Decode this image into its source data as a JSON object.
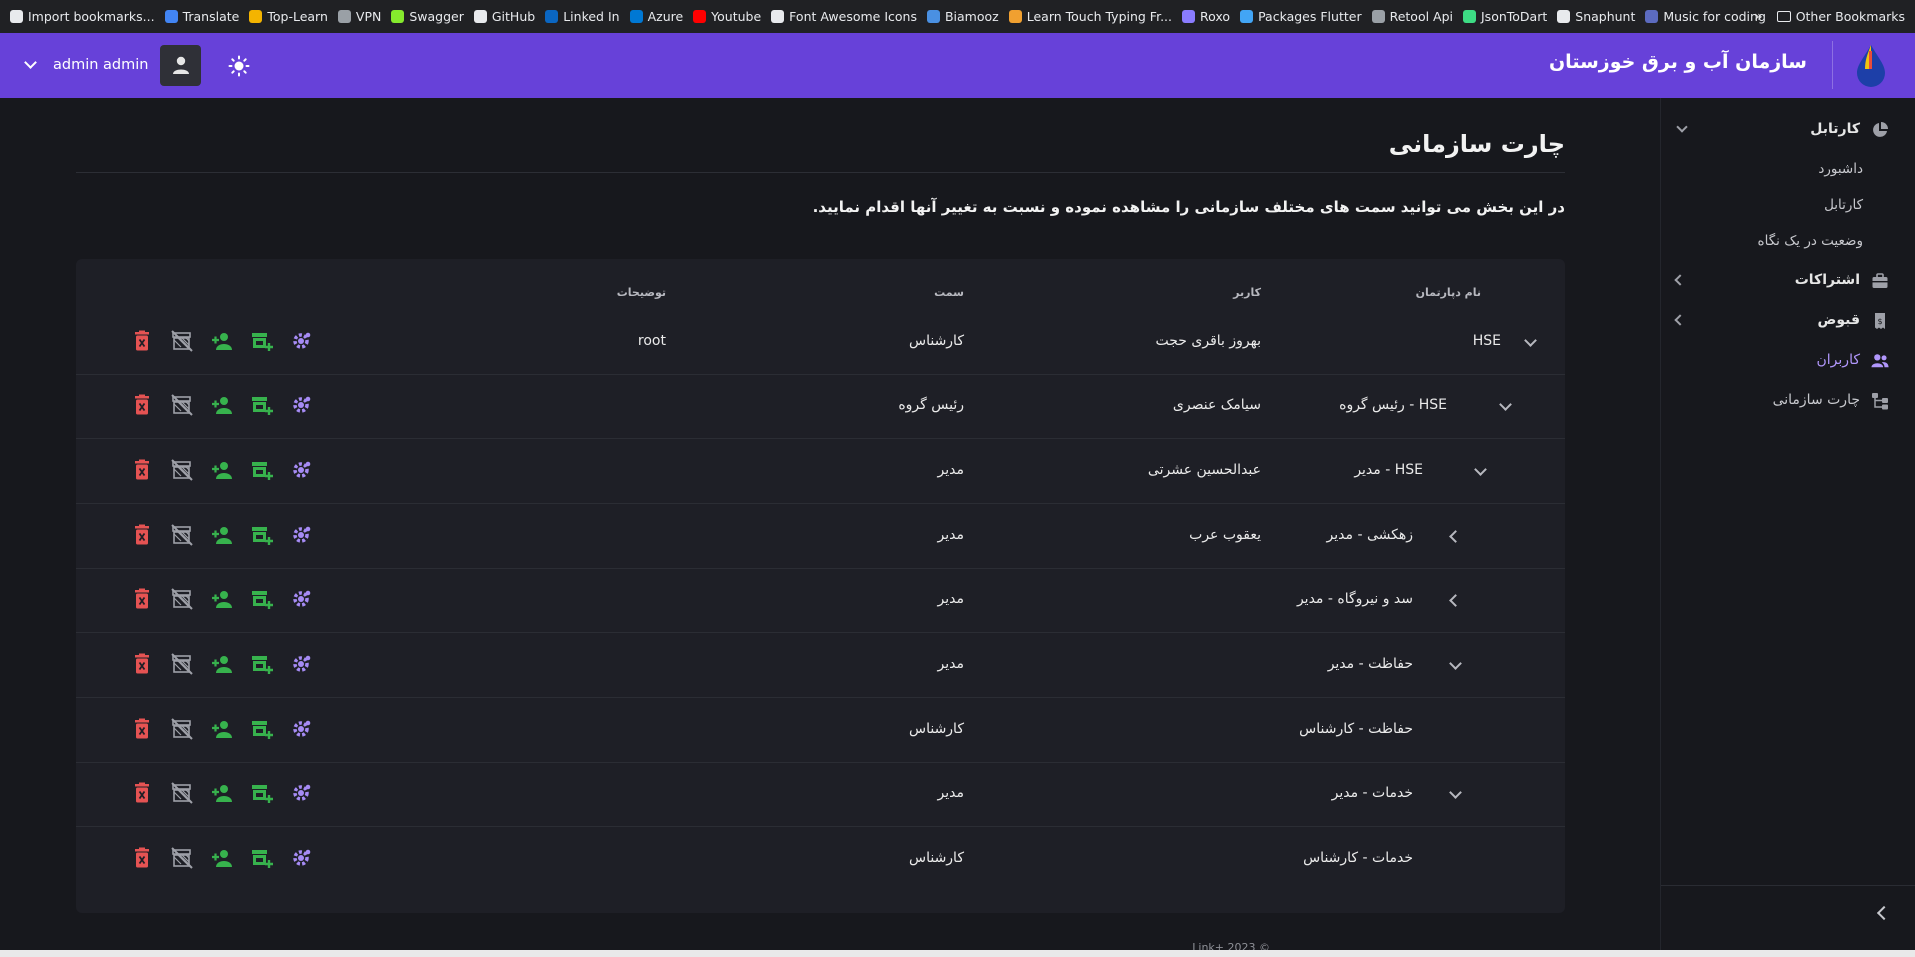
{
  "bookmarks": [
    {
      "label": "Import bookmarks...",
      "color": "#e8eaed"
    },
    {
      "label": "Translate",
      "color": "#4285f4"
    },
    {
      "label": "Top-Learn",
      "color": "#f4b400"
    },
    {
      "label": "VPN",
      "color": "#9aa0a6"
    },
    {
      "label": "Swagger",
      "color": "#85ea2d"
    },
    {
      "label": "GitHub",
      "color": "#e8eaed"
    },
    {
      "label": "Linked In",
      "color": "#0a66c2"
    },
    {
      "label": "Azure",
      "color": "#0078d4"
    },
    {
      "label": "Youtube",
      "color": "#ff0000"
    },
    {
      "label": "Font Awesome Icons",
      "color": "#e8eaed"
    },
    {
      "label": "Biamooz",
      "color": "#4a90e2"
    },
    {
      "label": "Learn Touch Typing Fr...",
      "color": "#f0a030"
    },
    {
      "label": "Roxo",
      "color": "#8a7cff"
    },
    {
      "label": "Packages Flutter",
      "color": "#42a5f5"
    },
    {
      "label": "Retool Api",
      "color": "#9aa0a6"
    },
    {
      "label": "JsonToDart",
      "color": "#3ddc84"
    },
    {
      "label": "Snaphunt",
      "color": "#e8eaed"
    },
    {
      "label": "Music for coding",
      "color": "#5c6bc0"
    }
  ],
  "bookmarks_other": "Other Bookmarks",
  "header": {
    "org_title": "سازمان آب و برق خوزستان",
    "user_name": "admin admin"
  },
  "sidebar": {
    "items": [
      {
        "label": "کارتابل",
        "icon": "pie-chart-icon",
        "expandable": true
      },
      {
        "label": "اشتراکات",
        "icon": "briefcase-icon",
        "expandable": true
      },
      {
        "label": "قبوض",
        "icon": "receipt-icon",
        "expandable": true
      },
      {
        "label": "کاربران",
        "icon": "users-icon",
        "expandable": false,
        "active": true
      },
      {
        "label": "چارت سازمانی",
        "icon": "org-chart-icon",
        "expandable": false
      }
    ],
    "sub_items": [
      "داشبورد",
      "کارتابل",
      "وضعیت در یک نگاه"
    ]
  },
  "page": {
    "title": "چارت سازمانی",
    "description": "در این بخش می توانید سمت های مختلف سازمانی را مشاهده نموده و نسبت به تغییر آنها اقدام نمایید."
  },
  "table": {
    "headers": {
      "department": "نام دپارتمان",
      "user": "کاربر",
      "position": "سمت",
      "notes": "توضیحات"
    },
    "rows": [
      {
        "department": "HSE",
        "user": "بهروز باقری حجت",
        "position": "کارشناس",
        "notes": "root",
        "level": 0,
        "toggle": "down"
      },
      {
        "department": "HSE - رئیس گروه",
        "user": "سیامک عنصری",
        "position": "رئیس گروه",
        "notes": "",
        "level": 1,
        "toggle": "down"
      },
      {
        "department": "HSE - مدیر",
        "user": "عبدالحسین عشرتی",
        "position": "مدیر",
        "notes": "",
        "level": 2,
        "toggle": "down"
      },
      {
        "department": "زهکشی - مدیر",
        "user": "یعقوب عرب",
        "position": "مدیر",
        "notes": "",
        "level": 3,
        "toggle": "left"
      },
      {
        "department": "سد و نیروگاه - مدیر",
        "user": "",
        "position": "مدیر",
        "notes": "",
        "level": 3,
        "toggle": "left"
      },
      {
        "department": "حفاظت - مدیر",
        "user": "",
        "position": "مدیر",
        "notes": "",
        "level": 3,
        "toggle": "down"
      },
      {
        "department": "حفاظت - کارشناس",
        "user": "",
        "position": "کارشناس",
        "notes": "",
        "level": 4,
        "toggle": ""
      },
      {
        "department": "خدمات - مدیر",
        "user": "",
        "position": "مدیر",
        "notes": "",
        "level": 3,
        "toggle": "down"
      },
      {
        "department": "خدمات - کارشناس",
        "user": "",
        "position": "کارشناس",
        "notes": "",
        "level": 4,
        "toggle": ""
      }
    ]
  },
  "footer": "Link+ 2023 ©",
  "colors": {
    "brand": "#6741d9",
    "action_purple": "#a68bf5",
    "action_green": "#37b24d",
    "action_red": "#e55353",
    "action_gray": "#9ea0a8"
  }
}
